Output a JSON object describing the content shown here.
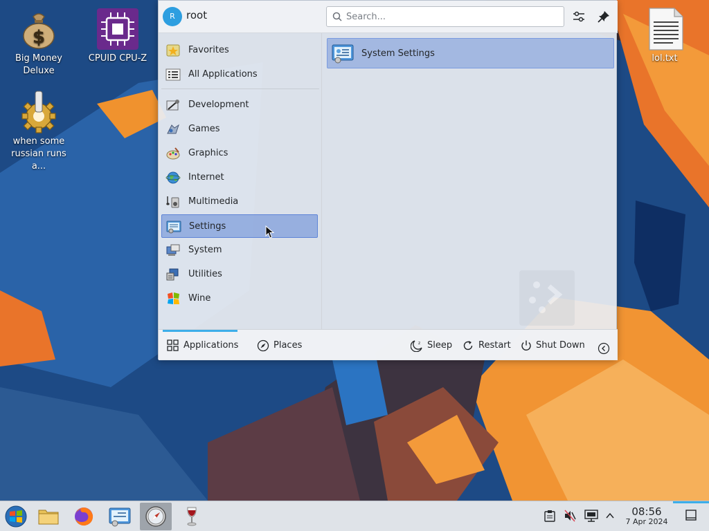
{
  "desktop": {
    "icons": [
      {
        "label": "Big Money Deluxe",
        "icon": "money-bag-icon"
      },
      {
        "label": "CPUID CPU-Z",
        "icon": "cpu-chip-icon"
      },
      {
        "label": "when some russian runs a...",
        "icon": "gear-icon"
      },
      {
        "label": "lol.txt",
        "icon": "text-file-icon"
      }
    ]
  },
  "launcher": {
    "user": {
      "initial": "R",
      "name": "root"
    },
    "search": {
      "placeholder": "Search...",
      "value": ""
    },
    "categories": [
      {
        "label": "Favorites",
        "icon": "star-icon"
      },
      {
        "label": "All Applications",
        "icon": "grid-icon"
      },
      {
        "label": "Development",
        "icon": "development-icon"
      },
      {
        "label": "Games",
        "icon": "games-icon"
      },
      {
        "label": "Graphics",
        "icon": "graphics-icon"
      },
      {
        "label": "Internet",
        "icon": "globe-icon"
      },
      {
        "label": "Multimedia",
        "icon": "multimedia-icon"
      },
      {
        "label": "Settings",
        "icon": "settings-icon"
      },
      {
        "label": "System",
        "icon": "system-icon"
      },
      {
        "label": "Utilities",
        "icon": "utilities-icon"
      },
      {
        "label": "Wine",
        "icon": "wine-icon"
      }
    ],
    "selected_category": "Settings",
    "apps": [
      {
        "label": "System Settings",
        "icon": "system-settings-icon"
      }
    ],
    "footer": {
      "applications_label": "Applications",
      "places_label": "Places",
      "sleep_label": "Sleep",
      "restart_label": "Restart",
      "shutdown_label": "Shut Down"
    }
  },
  "taskbar": {
    "items": [
      "start-menu-icon",
      "file-manager-icon",
      "firefox-icon",
      "system-settings-icon",
      "safari-icon",
      "wine-icon"
    ],
    "clock": {
      "time": "08:56",
      "date": "7 Apr 2024"
    }
  },
  "colors": {
    "accent": "#3daee9",
    "selection": "#5d83d6",
    "wallpaper_blue": "#1e4d86",
    "wallpaper_orange": "#f0922e"
  }
}
